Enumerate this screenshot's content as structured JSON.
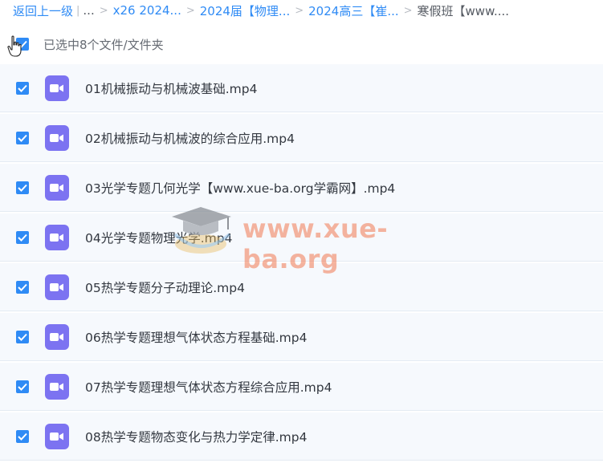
{
  "breadcrumb": {
    "back": "返回上一级",
    "ellipsis": "...",
    "crumbs": [
      "x26 2024...",
      "2024届【物理...",
      "2024高三【崔..."
    ],
    "current": "寒假班【www...."
  },
  "selection": {
    "label": "已选中8个文件/文件夹",
    "checked": true
  },
  "files": [
    {
      "name": "01机械振动与机械波基础.mp4",
      "checked": true
    },
    {
      "name": "02机械振动与机械波的综合应用.mp4",
      "checked": true
    },
    {
      "name": "03光学专题几何光学【www.xue-ba.org学霸网】.mp4",
      "checked": true
    },
    {
      "name": "04光学专题物理光学.mp4",
      "checked": true
    },
    {
      "name": "05热学专题分子动理论.mp4",
      "checked": true
    },
    {
      "name": "06热学专题理想气体状态方程基础.mp4",
      "checked": true
    },
    {
      "name": "07热学专题理想气体状态方程综合应用.mp4",
      "checked": true
    },
    {
      "name": "08热学专题物态变化与热力学定律.mp4",
      "checked": true
    }
  ],
  "watermark": {
    "text": "www.xue-ba.org",
    "icon": "graduation-cap-logo"
  },
  "colors": {
    "link": "#2f8bf5",
    "checkbox": "#2f8bf5",
    "video_icon": "#7c73f1",
    "row_bg": "#f6f9fd"
  }
}
